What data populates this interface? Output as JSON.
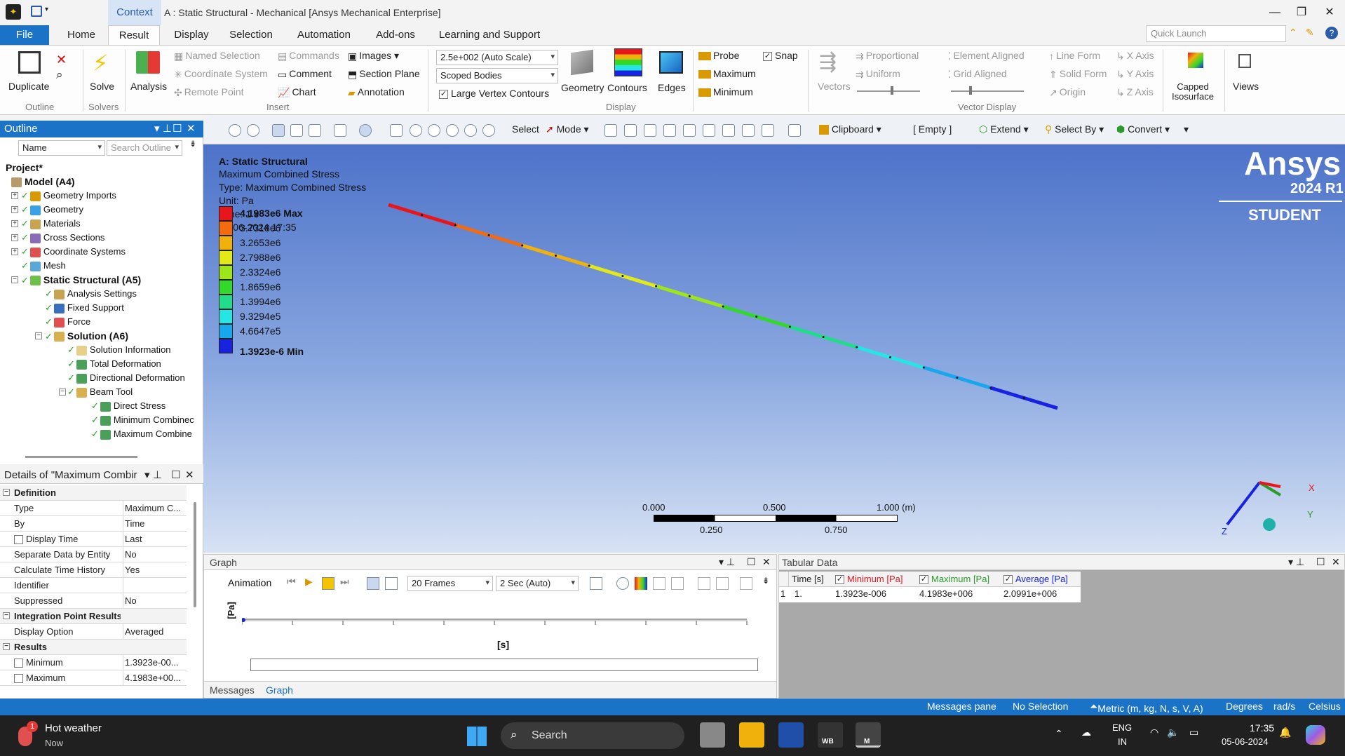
{
  "window": {
    "context_tab": "Context",
    "title": "A : Static Structural - Mechanical [Ansys Mechanical Enterprise]"
  },
  "menu": {
    "file": "File",
    "tabs": [
      "Home",
      "Result",
      "Display",
      "Selection",
      "Automation",
      "Add-ons",
      "Learning and Support"
    ],
    "quick_launch_placeholder": "Quick Launch"
  },
  "ribbon": {
    "outline_group": {
      "duplicate": "Duplicate",
      "label": "Outline"
    },
    "solve_group": {
      "solve": "Solve",
      "label": "Solvers"
    },
    "insert_group": {
      "analysis": "Analysis",
      "named_selection": "Named Selection",
      "coordinate_system": "Coordinate System",
      "remote_point": "Remote Point",
      "commands": "Commands",
      "comment": "Comment",
      "chart": "Chart",
      "images": "Images",
      "section_plane": "Section Plane",
      "annotation": "Annotation",
      "label": "Insert"
    },
    "display_group": {
      "scale": "2.5e+002 (Auto Scale)",
      "scoped": "Scoped Bodies",
      "large_vertex": "Large Vertex Contours",
      "geometry": "Geometry",
      "contours": "Contours",
      "edges": "Edges",
      "label": "Display"
    },
    "probe_group": {
      "probe": "Probe",
      "maximum": "Maximum",
      "minimum": "Minimum",
      "snap": "Snap"
    },
    "vector_group": {
      "vectors": "Vectors",
      "proportional": "Proportional",
      "uniform": "Uniform",
      "element_aligned": "Element Aligned",
      "grid_aligned": "Grid Aligned",
      "line_form": "Line Form",
      "solid_form": "Solid Form",
      "origin": "Origin",
      "x_axis": "X Axis",
      "y_axis": "Y Axis",
      "z_axis": "Z Axis",
      "label": "Vector Display"
    },
    "capped": "Capped Isosurface",
    "views": "Views"
  },
  "toolbar": {
    "select": "Select",
    "mode": "Mode",
    "clipboard": "Clipboard",
    "empty": "[ Empty ]",
    "extend": "Extend",
    "select_by": "Select By",
    "convert": "Convert"
  },
  "outline": {
    "title": "Outline",
    "name_filter": "Name",
    "search_placeholder": "Search Outline",
    "project": "Project*",
    "model": "Model (A4)",
    "geometry_imports": "Geometry Imports",
    "geometry": "Geometry",
    "materials": "Materials",
    "cross_sections": "Cross Sections",
    "coordinate_systems": "Coordinate Systems",
    "mesh": "Mesh",
    "static_structural": "Static Structural (A5)",
    "analysis_settings": "Analysis Settings",
    "fixed_support": "Fixed Support",
    "force": "Force",
    "solution": "Solution (A6)",
    "solution_information": "Solution Information",
    "total_deformation": "Total Deformation",
    "directional_deformation": "Directional Deformation",
    "beam_tool": "Beam Tool",
    "direct_stress": "Direct Stress",
    "minimum_combined": "Minimum Combinec",
    "maximum_combined": "Maximum Combine"
  },
  "details": {
    "title": "Details of \"Maximum Combir",
    "definition": "Definition",
    "type_k": "Type",
    "type_v": "Maximum C...",
    "by_k": "By",
    "by_v": "Time",
    "display_time_k": "Display Time",
    "display_time_v": "Last",
    "separate_k": "Separate Data by Entity",
    "separate_v": "No",
    "calc_k": "Calculate Time History",
    "calc_v": "Yes",
    "identifier_k": "Identifier",
    "identifier_v": "",
    "suppressed_k": "Suppressed",
    "suppressed_v": "No",
    "integration": "Integration Point Results",
    "display_option_k": "Display Option",
    "display_option_v": "Averaged",
    "results": "Results",
    "minimum_k": "Minimum",
    "minimum_v": "1.3923e-00...",
    "maximum_k": "Maximum",
    "maximum_v": "4.1983e+00..."
  },
  "viewport": {
    "header": "A: Static Structural",
    "line1": "Maximum Combined Stress",
    "line2": "Type: Maximum Combined Stress",
    "line3": "Unit: Pa",
    "line4": "Time: 1 s",
    "line5": "05-06-2024 17:35",
    "legend": [
      {
        "label": "4.1983e6 Max",
        "color": "#e8161b"
      },
      {
        "label": "3.7318e6",
        "color": "#f26b10"
      },
      {
        "label": "3.2653e6",
        "color": "#f0b10c"
      },
      {
        "label": "2.7988e6",
        "color": "#e2e916"
      },
      {
        "label": "2.3324e6",
        "color": "#9ee519"
      },
      {
        "label": "1.8659e6",
        "color": "#32d92a"
      },
      {
        "label": "1.3994e6",
        "color": "#21dc8a"
      },
      {
        "label": "9.3294e5",
        "color": "#26e5e5"
      },
      {
        "label": "4.6647e5",
        "color": "#16a7ec"
      },
      {
        "label": "1.3923e-6 Min",
        "color": "#1723e0"
      }
    ],
    "brand1": "Ansys",
    "brand2": "2024 R1",
    "brand3": "STUDENT",
    "scale_labels": [
      "0.000",
      "0.500",
      "1.000 (m)"
    ],
    "scale_labels2": [
      "0.250",
      "0.750"
    ],
    "axis_x": "X",
    "axis_y": "Y",
    "axis_z": "Z"
  },
  "graph": {
    "title": "Graph",
    "animation": "Animation",
    "frames": "20 Frames",
    "duration": "2 Sec (Auto)",
    "ylabel": "[Pa]",
    "xlabel": "[s]",
    "tab_messages": "Messages",
    "tab_graph": "Graph"
  },
  "tabular": {
    "title": "Tabular Data",
    "headers": [
      "Time [s]",
      "Minimum [Pa]",
      "Maximum [Pa]",
      "Average [Pa]"
    ],
    "row_index": "1",
    "row": [
      "1.",
      "1.3923e-006",
      "4.1983e+006",
      "2.0991e+006"
    ]
  },
  "status": {
    "messages": "Messages pane",
    "selection": "No Selection",
    "units": "Metric (m, kg, N, s, V, A)",
    "degrees": "Degrees",
    "rads": "rad/s",
    "celsius": "Celsius"
  },
  "taskbar": {
    "weather_badge": "1",
    "weather": "Hot weather",
    "weather_sub": "Now",
    "search": "Search",
    "lang1": "ENG",
    "lang2": "IN",
    "time": "17:35",
    "date": "05-06-2024",
    "wb": "WB",
    "m": "M"
  }
}
